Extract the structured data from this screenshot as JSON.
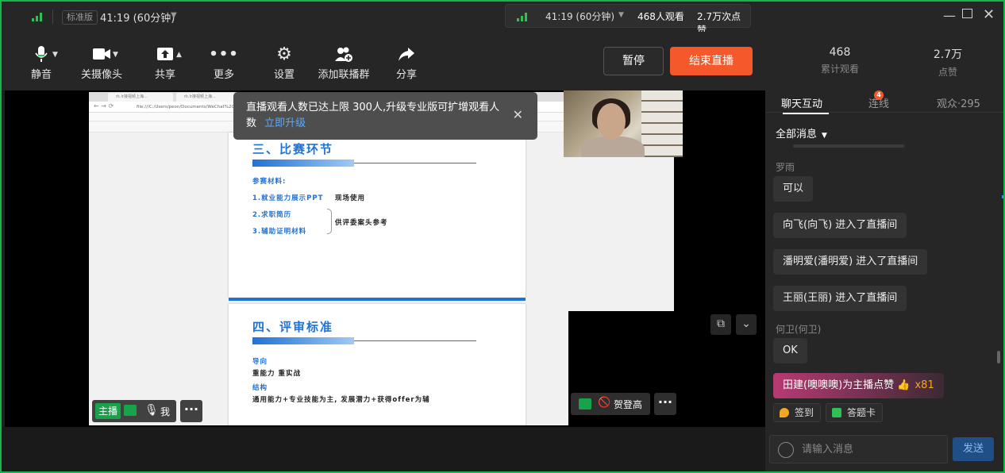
{
  "titlebar": {
    "edition_badge": "标准版",
    "timer": "41:19 (60分钟)",
    "pill": {
      "timer": "41:19 (60分钟)",
      "viewers": "468人观看",
      "likes": "2.7万次点赞"
    }
  },
  "toolbar": {
    "mute": "静音",
    "camera_off": "关摄像头",
    "share": "共享",
    "more": "更多",
    "settings": "设置",
    "add_co_stream": "添加联播群",
    "share_link": "分享",
    "pause": "暂停",
    "end_live": "结束直播"
  },
  "toast": {
    "message": "直播观看人数已达上限 300人,升级专业版可扩增观看人数",
    "link": "立即升级"
  },
  "slides": {
    "browser_tab1": "rk.lr接视频上海...",
    "browser_tab2": "rk.lr接视频上海...",
    "address": "file:///C:/Users/peon/Documents/WeChat%20...",
    "section3_title": "三、比赛环节",
    "materials_label": "参赛材料:",
    "item1": "1.就业能力展示PPT",
    "item1_note": "现场使用",
    "item2": "2.求职简历",
    "item3": "3.辅助证明材料",
    "items_note": "供评委案头参考",
    "section4_title": "四、评审标准",
    "orientation_label": "导向",
    "orientation_text": "重能力  重实战",
    "structure_label": "结构",
    "structure_text": "通用能力+专业技能为主, 发展潜力+获得offer为辅"
  },
  "stage": {
    "host_tag": "主播",
    "host_name": "我",
    "guest_name": "贺登高"
  },
  "panel": {
    "stats": [
      {
        "value": "468",
        "label": "累计观看"
      },
      {
        "value": "2.7万",
        "label": "点赞"
      }
    ],
    "tabs": {
      "chat": "聊天互动",
      "connect": "连线",
      "connect_badge": "4",
      "audience": "观众·295"
    },
    "filter": "全部消息",
    "messages": [
      {
        "sender": "罗雨",
        "text": "可以"
      },
      {
        "sender": "",
        "text": "向飞(向飞) 进入了直播间"
      },
      {
        "sender": "",
        "text": "潘明爱(潘明爱) 进入了直播间"
      },
      {
        "sender": "",
        "text": "王丽(王丽) 进入了直播间"
      },
      {
        "sender": "何卫(何卫)",
        "text": "OK"
      }
    ],
    "like_notice": "田建(噢噢噢)为主播点赞",
    "like_count": "x81",
    "checkin": "签到",
    "answer_card": "答题卡",
    "input_placeholder": "请输入消息",
    "send": "发送"
  },
  "colors": {
    "accent": "#f5592b",
    "brand_green": "#16b54a",
    "link": "#5aa9ff",
    "slide_blue": "#1f72d6"
  }
}
